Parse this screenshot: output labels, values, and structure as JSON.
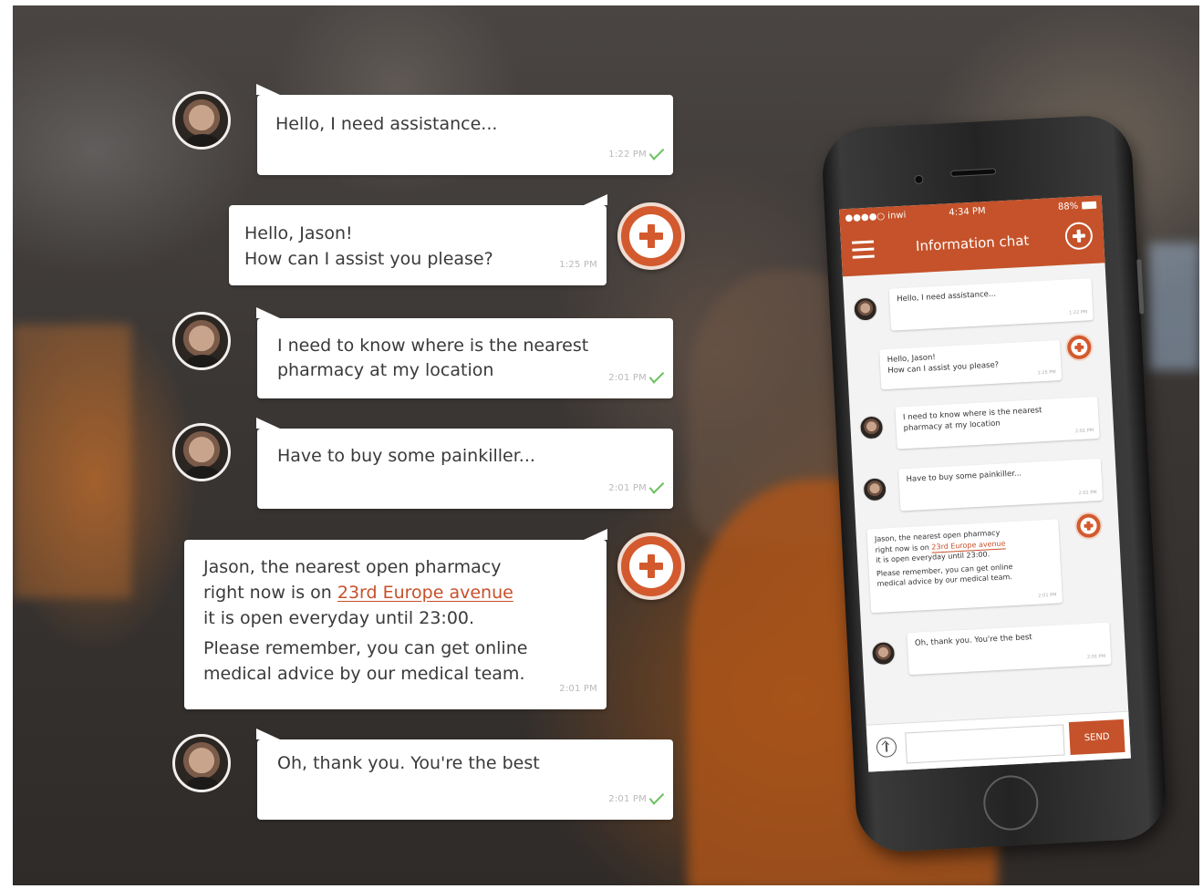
{
  "app": {
    "status": {
      "carrier": "●●●●○ inwi",
      "clock": "4:34 PM",
      "battery": "88%"
    },
    "title": "Information chat",
    "send_label": "SEND",
    "input_placeholder": ""
  },
  "messages": [
    {
      "from": "user",
      "text": "Hello, I need assistance...",
      "time": "1:22 PM"
    },
    {
      "from": "agent",
      "lines": [
        "Hello, Jason!",
        "How can I assist you please?"
      ],
      "time": "1:25 PM"
    },
    {
      "from": "user",
      "lines": [
        "I need  to know where is the nearest",
        "pharmacy at my location"
      ],
      "time": "2:01 PM"
    },
    {
      "from": "user",
      "text": "Have to buy some painkiller...",
      "time": "2:01 PM"
    },
    {
      "from": "agent",
      "line1": "Jason, the nearest open pharmacy",
      "line2_prefix": "right now is on ",
      "link": "23rd Europe avenue",
      "line3": "it is open everyday until 23:00.",
      "line4": "Please remember, you can get online",
      "line5": "medical advice by our medical team.",
      "time": "2:01 PM"
    },
    {
      "from": "user",
      "text": "Oh, thank you. You're the best",
      "time": "2:01 PM"
    }
  ],
  "colors": {
    "accent": "#c5522a",
    "badge": "#d35a2e",
    "read_check": "#6ac15f"
  },
  "icons": {
    "agent": "medical-cross-icon",
    "read": "double-check-icon",
    "menu": "hamburger-menu-icon",
    "upload": "upload-arrow-icon"
  }
}
